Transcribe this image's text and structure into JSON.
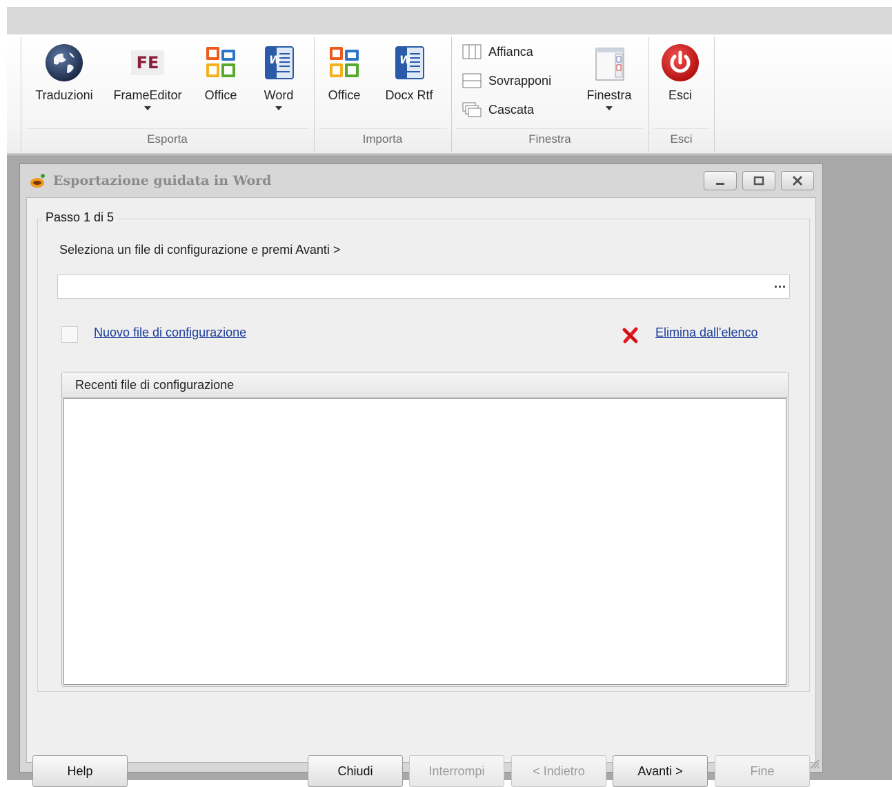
{
  "ribbon": {
    "groups": {
      "esporta": "Esporta",
      "importa": "Importa",
      "finestra": "Finestra",
      "esci": "Esci"
    },
    "buttons": {
      "traduzioni": "Traduzioni",
      "frameeditor": "FrameEditor",
      "office_export": "Office",
      "word_export": "Word",
      "office_import": "Office",
      "docx_rtf": "Docx Rtf",
      "affianca": "Affianca",
      "sovrapponi": "Sovrapponi",
      "cascata": "Cascata",
      "finestra": "Finestra",
      "esci": "Esci"
    },
    "icon_text": {
      "fe": "FE"
    }
  },
  "dialog": {
    "title": "Esportazione guidata in Word",
    "step": "Passo 1 di 5",
    "instruction": "Seleziona un file di configurazione e premi Avanti >",
    "file_field": {
      "value": "",
      "browse_label": "..."
    },
    "new_config_link": "Nuovo file di configurazione",
    "delete_link": "Elimina dall'elenco",
    "recent_title": "Recenti file di configurazione",
    "buttons": {
      "help": "Help",
      "chiudi": "Chiudi",
      "interrompi": "Interrompi",
      "indietro": "< Indietro",
      "avanti": "Avanti >",
      "fine": "Fine"
    }
  },
  "colors": {
    "link": "#1b3d9c",
    "close_icon": "#e8161e",
    "globe": "#2b3f63",
    "office_orange": "#ee5a1c",
    "word_blue": "#2a5aa8",
    "exit_red": "#d71f1f"
  },
  "icons": [
    "globe-icon",
    "frameeditor-icon",
    "office-icon",
    "word-icon",
    "tile-icon",
    "overlap-icon",
    "cascade-icon",
    "window-icon",
    "power-icon",
    "delete-x-icon",
    "app-icon"
  ]
}
